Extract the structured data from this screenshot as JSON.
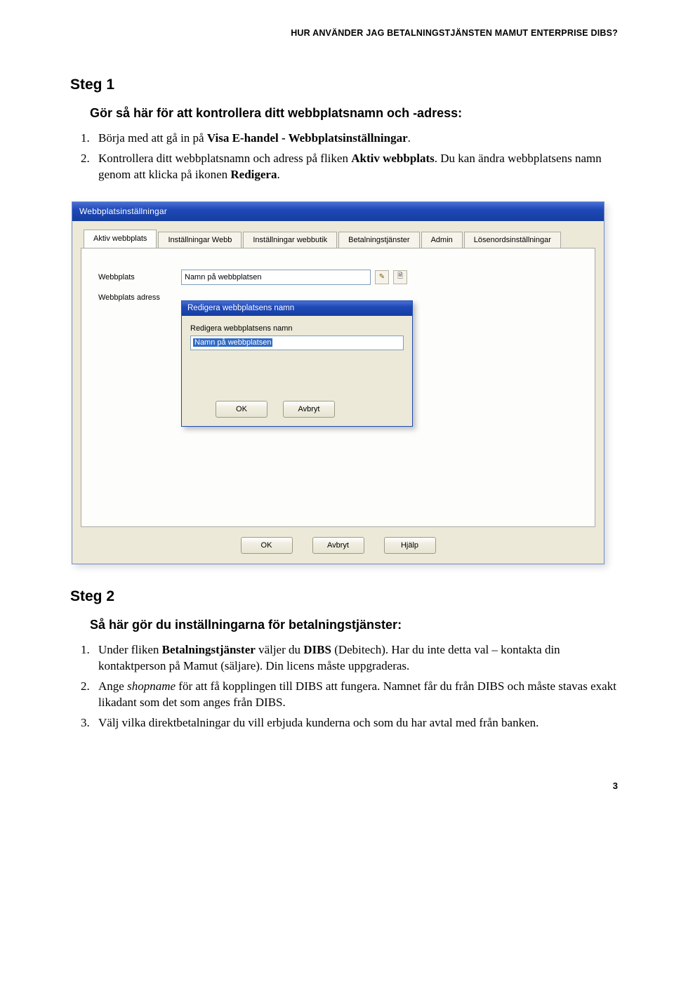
{
  "running_head": "HUR ANVÄNDER JAG BETALNINGSTJÄNSTEN MAMUT ENTERPRISE DIBS?",
  "step1": {
    "heading": "Steg 1",
    "sub": "Gör så här för att kontrollera ditt webbplatsnamn och -adress:",
    "items": {
      "i1_pre": "Börja med att gå in på ",
      "i1_bold": "Visa E-handel - Webbplatsinställningar",
      "i1_post": ".",
      "i2_a": "Kontrollera ditt webbplatsnamn och adress på fliken ",
      "i2_b": "Aktiv webbplats",
      "i2_c": ". Du kan ändra webbplatsens namn genom att klicka på ikonen ",
      "i2_d": "Redigera",
      "i2_e": "."
    }
  },
  "screenshot": {
    "dialog_title": "Webbplatsinställningar",
    "tabs": {
      "t1": "Aktiv webbplats",
      "t2": "Inställningar Webb",
      "t3": "Inställningar webbutik",
      "t4": "Betalningstjänster",
      "t5": "Admin",
      "t6": "Lösenordsinställningar"
    },
    "labels": {
      "webbplats": "Webbplats",
      "webbplats_adress": "Webbplats adress"
    },
    "field_webbplats_value": "Namn på webbplatsen",
    "modal": {
      "title": "Redigera webbplatsens namn",
      "msg": "Redigera webbplatsens namn",
      "value": "Namn på webbplatsen",
      "ok": "OK",
      "cancel": "Avbryt"
    },
    "outer_buttons": {
      "ok": "OK",
      "cancel": "Avbryt",
      "help": "Hjälp"
    }
  },
  "step2": {
    "heading": "Steg 2",
    "sub": "Så här gör du inställningarna för betalningstjänster:",
    "items": {
      "i1_a": "Under fliken ",
      "i1_b": "Betalningstjänster",
      "i1_c": " väljer du ",
      "i1_d": "DIBS",
      "i1_e": " (Debitech). Har du inte detta val – kontakta din kontaktperson på Mamut (säljare). Din licens måste uppgraderas.",
      "i2_a": "Ange ",
      "i2_b": "shopname",
      "i2_c": " för att få kopplingen till DIBS att fungera. Namnet får du från DIBS och måste stavas exakt likadant som det som anges från DIBS.",
      "i3": "Välj vilka direktbetalningar du vill erbjuda kunderna och som du har avtal med från banken."
    }
  },
  "page_number": "3"
}
